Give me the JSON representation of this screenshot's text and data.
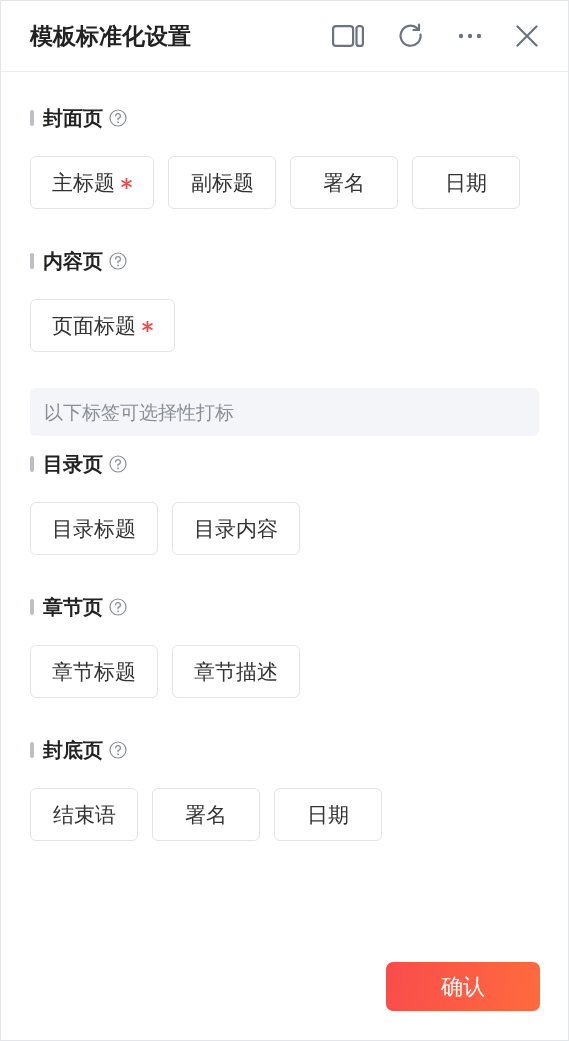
{
  "window": {
    "title": "模板标准化设置"
  },
  "blocks": [
    {
      "kind": "section",
      "title": "封面页",
      "tags": [
        {
          "label": "主标题",
          "required": true
        },
        {
          "label": "副标题",
          "required": false
        },
        {
          "label": "署名",
          "required": false
        },
        {
          "label": "日期",
          "required": false
        }
      ]
    },
    {
      "kind": "section",
      "title": "内容页",
      "tags": [
        {
          "label": "页面标题",
          "required": true
        }
      ]
    },
    {
      "kind": "note",
      "text": "以下标签可选择性打标"
    },
    {
      "kind": "section",
      "title": "目录页",
      "tags": [
        {
          "label": "目录标题",
          "required": false
        },
        {
          "label": "目录内容",
          "required": false
        }
      ]
    },
    {
      "kind": "section",
      "title": "章节页",
      "tags": [
        {
          "label": "章节标题",
          "required": false
        },
        {
          "label": "章节描述",
          "required": false
        }
      ]
    },
    {
      "kind": "section",
      "title": "封底页",
      "tags": [
        {
          "label": "结束语",
          "required": false
        },
        {
          "label": "署名",
          "required": false
        },
        {
          "label": "日期",
          "required": false
        }
      ]
    }
  ],
  "confirm": "确认"
}
